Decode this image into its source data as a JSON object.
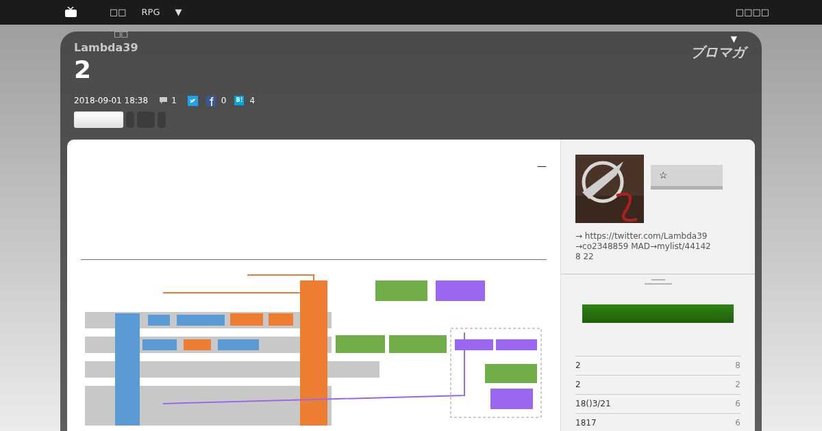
{
  "top_bar": {
    "nav": [
      {
        "label": "□□"
      },
      {
        "label": "RPG"
      },
      {
        "label": "▼"
      }
    ],
    "right_link": "□□□□"
  },
  "header": {
    "nav_note": "□□",
    "author": "Lambda39",
    "title": "2",
    "menu_caret": "▼",
    "logo": "ブロマガ",
    "date": "2018-09-01 18:38",
    "comments": "1",
    "facebook_count": "0",
    "hatena_label": "B!",
    "hatena_count": "4"
  },
  "article": {
    "dash": "—"
  },
  "sidebar": {
    "profile": "→ https://twitter.com/Lambda39 →co2348859 MAD→mylist/441428 22",
    "follow_icon": "☆",
    "list": [
      {
        "title": "2",
        "count": "8"
      },
      {
        "title": "2",
        "count": "2"
      },
      {
        "title": "18()3/21",
        "count": "6"
      },
      {
        "title": "1817",
        "count": "6"
      }
    ]
  }
}
